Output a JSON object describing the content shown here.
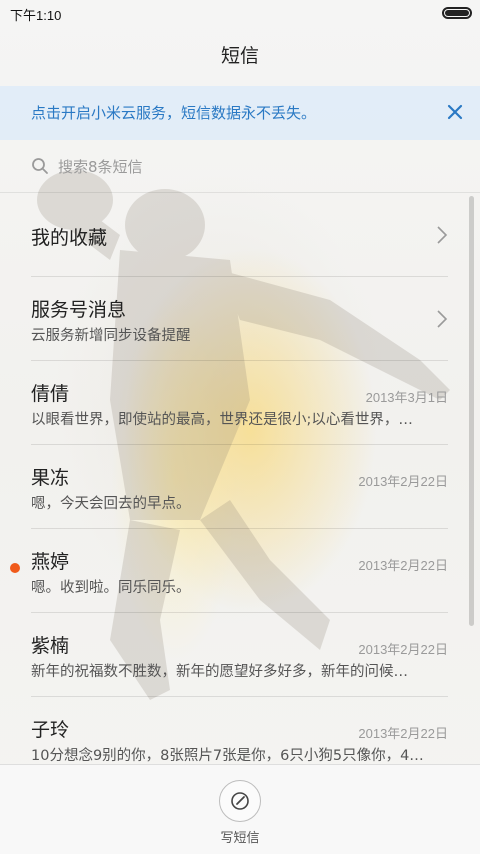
{
  "status_bar": {
    "time": "下午1:10"
  },
  "header": {
    "title": "短信"
  },
  "banner": {
    "text": "点击开启小米云服务，短信数据永不丢失。"
  },
  "search": {
    "placeholder": "搜索8条短信"
  },
  "conversations": [
    {
      "title": "我的收藏",
      "subtitle": "",
      "date": ""
    },
    {
      "title": "服务号消息",
      "subtitle": "云服务新增同步设备提醒",
      "date": ""
    },
    {
      "title": "倩倩",
      "subtitle": "以眼看世界，即使站的最高，世界还是很小;以心看世界，…",
      "date": "2013年3月1日"
    },
    {
      "title": "果冻",
      "subtitle": "嗯，今天会回去的早点。",
      "date": "2013年2月22日"
    },
    {
      "title": "燕婷",
      "subtitle": "嗯。收到啦。同乐同乐。",
      "date": "2013年2月22日",
      "unread": true
    },
    {
      "title": "紫楠",
      "subtitle": "新年的祝福数不胜数，新年的愿望好多好多，新年的问候…",
      "date": "2013年2月22日"
    },
    {
      "title": "子玲",
      "subtitle": "10分想念9别的你，8张照片7张是你，6只小狗5只像你，4…",
      "date": "2013年2月22日"
    }
  ],
  "bottom_bar": {
    "compose_label": "写短信"
  },
  "colors": {
    "accent": "#2a79c4",
    "unread_dot": "#f05a1a",
    "banner_bg": "#e0ecf8"
  },
  "icons": {
    "search": "search-icon",
    "close": "close-icon",
    "chevron": "chevron-right-icon",
    "compose": "compose-icon"
  }
}
